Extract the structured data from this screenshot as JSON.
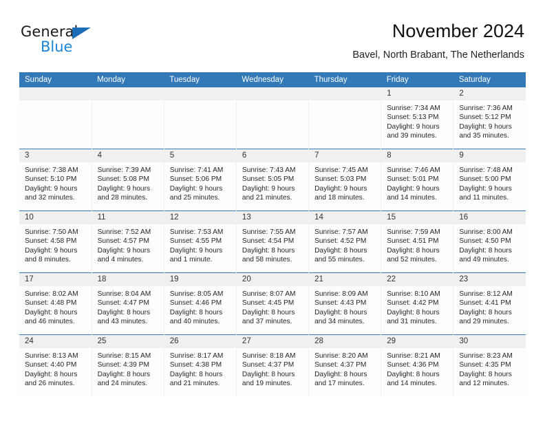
{
  "brand": {
    "name_top": "General",
    "name_bottom": "Blue",
    "triangle_color": "#1b6eb5",
    "blue_color": "#1b85d6"
  },
  "header": {
    "title": "November 2024",
    "subtitle": "Bavel, North Brabant, The Netherlands",
    "accent_color": "#3479b7"
  },
  "weekday_headers": [
    "Sunday",
    "Monday",
    "Tuesday",
    "Wednesday",
    "Thursday",
    "Friday",
    "Saturday"
  ],
  "weeks": [
    [
      {
        "day": "",
        "sunrise": "",
        "sunset": "",
        "daylight1": "",
        "daylight2": ""
      },
      {
        "day": "",
        "sunrise": "",
        "sunset": "",
        "daylight1": "",
        "daylight2": ""
      },
      {
        "day": "",
        "sunrise": "",
        "sunset": "",
        "daylight1": "",
        "daylight2": ""
      },
      {
        "day": "",
        "sunrise": "",
        "sunset": "",
        "daylight1": "",
        "daylight2": ""
      },
      {
        "day": "",
        "sunrise": "",
        "sunset": "",
        "daylight1": "",
        "daylight2": ""
      },
      {
        "day": "1",
        "sunrise": "Sunrise: 7:34 AM",
        "sunset": "Sunset: 5:13 PM",
        "daylight1": "Daylight: 9 hours",
        "daylight2": "and 39 minutes."
      },
      {
        "day": "2",
        "sunrise": "Sunrise: 7:36 AM",
        "sunset": "Sunset: 5:12 PM",
        "daylight1": "Daylight: 9 hours",
        "daylight2": "and 35 minutes."
      }
    ],
    [
      {
        "day": "3",
        "sunrise": "Sunrise: 7:38 AM",
        "sunset": "Sunset: 5:10 PM",
        "daylight1": "Daylight: 9 hours",
        "daylight2": "and 32 minutes."
      },
      {
        "day": "4",
        "sunrise": "Sunrise: 7:39 AM",
        "sunset": "Sunset: 5:08 PM",
        "daylight1": "Daylight: 9 hours",
        "daylight2": "and 28 minutes."
      },
      {
        "day": "5",
        "sunrise": "Sunrise: 7:41 AM",
        "sunset": "Sunset: 5:06 PM",
        "daylight1": "Daylight: 9 hours",
        "daylight2": "and 25 minutes."
      },
      {
        "day": "6",
        "sunrise": "Sunrise: 7:43 AM",
        "sunset": "Sunset: 5:05 PM",
        "daylight1": "Daylight: 9 hours",
        "daylight2": "and 21 minutes."
      },
      {
        "day": "7",
        "sunrise": "Sunrise: 7:45 AM",
        "sunset": "Sunset: 5:03 PM",
        "daylight1": "Daylight: 9 hours",
        "daylight2": "and 18 minutes."
      },
      {
        "day": "8",
        "sunrise": "Sunrise: 7:46 AM",
        "sunset": "Sunset: 5:01 PM",
        "daylight1": "Daylight: 9 hours",
        "daylight2": "and 14 minutes."
      },
      {
        "day": "9",
        "sunrise": "Sunrise: 7:48 AM",
        "sunset": "Sunset: 5:00 PM",
        "daylight1": "Daylight: 9 hours",
        "daylight2": "and 11 minutes."
      }
    ],
    [
      {
        "day": "10",
        "sunrise": "Sunrise: 7:50 AM",
        "sunset": "Sunset: 4:58 PM",
        "daylight1": "Daylight: 9 hours",
        "daylight2": "and 8 minutes."
      },
      {
        "day": "11",
        "sunrise": "Sunrise: 7:52 AM",
        "sunset": "Sunset: 4:57 PM",
        "daylight1": "Daylight: 9 hours",
        "daylight2": "and 4 minutes."
      },
      {
        "day": "12",
        "sunrise": "Sunrise: 7:53 AM",
        "sunset": "Sunset: 4:55 PM",
        "daylight1": "Daylight: 9 hours",
        "daylight2": "and 1 minute."
      },
      {
        "day": "13",
        "sunrise": "Sunrise: 7:55 AM",
        "sunset": "Sunset: 4:54 PM",
        "daylight1": "Daylight: 8 hours",
        "daylight2": "and 58 minutes."
      },
      {
        "day": "14",
        "sunrise": "Sunrise: 7:57 AM",
        "sunset": "Sunset: 4:52 PM",
        "daylight1": "Daylight: 8 hours",
        "daylight2": "and 55 minutes."
      },
      {
        "day": "15",
        "sunrise": "Sunrise: 7:59 AM",
        "sunset": "Sunset: 4:51 PM",
        "daylight1": "Daylight: 8 hours",
        "daylight2": "and 52 minutes."
      },
      {
        "day": "16",
        "sunrise": "Sunrise: 8:00 AM",
        "sunset": "Sunset: 4:50 PM",
        "daylight1": "Daylight: 8 hours",
        "daylight2": "and 49 minutes."
      }
    ],
    [
      {
        "day": "17",
        "sunrise": "Sunrise: 8:02 AM",
        "sunset": "Sunset: 4:48 PM",
        "daylight1": "Daylight: 8 hours",
        "daylight2": "and 46 minutes."
      },
      {
        "day": "18",
        "sunrise": "Sunrise: 8:04 AM",
        "sunset": "Sunset: 4:47 PM",
        "daylight1": "Daylight: 8 hours",
        "daylight2": "and 43 minutes."
      },
      {
        "day": "19",
        "sunrise": "Sunrise: 8:05 AM",
        "sunset": "Sunset: 4:46 PM",
        "daylight1": "Daylight: 8 hours",
        "daylight2": "and 40 minutes."
      },
      {
        "day": "20",
        "sunrise": "Sunrise: 8:07 AM",
        "sunset": "Sunset: 4:45 PM",
        "daylight1": "Daylight: 8 hours",
        "daylight2": "and 37 minutes."
      },
      {
        "day": "21",
        "sunrise": "Sunrise: 8:09 AM",
        "sunset": "Sunset: 4:43 PM",
        "daylight1": "Daylight: 8 hours",
        "daylight2": "and 34 minutes."
      },
      {
        "day": "22",
        "sunrise": "Sunrise: 8:10 AM",
        "sunset": "Sunset: 4:42 PM",
        "daylight1": "Daylight: 8 hours",
        "daylight2": "and 31 minutes."
      },
      {
        "day": "23",
        "sunrise": "Sunrise: 8:12 AM",
        "sunset": "Sunset: 4:41 PM",
        "daylight1": "Daylight: 8 hours",
        "daylight2": "and 29 minutes."
      }
    ],
    [
      {
        "day": "24",
        "sunrise": "Sunrise: 8:13 AM",
        "sunset": "Sunset: 4:40 PM",
        "daylight1": "Daylight: 8 hours",
        "daylight2": "and 26 minutes."
      },
      {
        "day": "25",
        "sunrise": "Sunrise: 8:15 AM",
        "sunset": "Sunset: 4:39 PM",
        "daylight1": "Daylight: 8 hours",
        "daylight2": "and 24 minutes."
      },
      {
        "day": "26",
        "sunrise": "Sunrise: 8:17 AM",
        "sunset": "Sunset: 4:38 PM",
        "daylight1": "Daylight: 8 hours",
        "daylight2": "and 21 minutes."
      },
      {
        "day": "27",
        "sunrise": "Sunrise: 8:18 AM",
        "sunset": "Sunset: 4:37 PM",
        "daylight1": "Daylight: 8 hours",
        "daylight2": "and 19 minutes."
      },
      {
        "day": "28",
        "sunrise": "Sunrise: 8:20 AM",
        "sunset": "Sunset: 4:37 PM",
        "daylight1": "Daylight: 8 hours",
        "daylight2": "and 17 minutes."
      },
      {
        "day": "29",
        "sunrise": "Sunrise: 8:21 AM",
        "sunset": "Sunset: 4:36 PM",
        "daylight1": "Daylight: 8 hours",
        "daylight2": "and 14 minutes."
      },
      {
        "day": "30",
        "sunrise": "Sunrise: 8:23 AM",
        "sunset": "Sunset: 4:35 PM",
        "daylight1": "Daylight: 8 hours",
        "daylight2": "and 12 minutes."
      }
    ]
  ]
}
